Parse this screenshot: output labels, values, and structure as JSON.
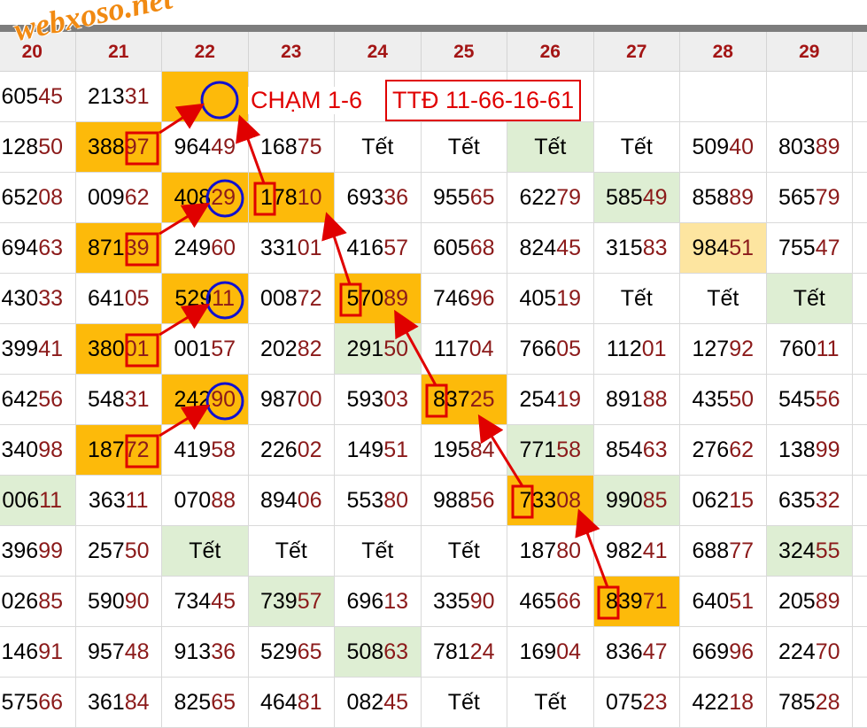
{
  "logo": {
    "text": "webxoso.net"
  },
  "headers": [
    "20",
    "21",
    "22",
    "23",
    "24",
    "25",
    "26",
    "27",
    "28",
    "29"
  ],
  "rows": [
    [
      "60545",
      "21331",
      "",
      "",
      "",
      "",
      "",
      "",
      "",
      ""
    ],
    [
      "12850",
      "38897",
      "96449",
      "16875",
      "Tết",
      "Tết",
      "Tết",
      "Tết",
      "50940",
      "80389"
    ],
    [
      "65208",
      "00962",
      "40829",
      "17810",
      "69336",
      "95565",
      "62279",
      "58549",
      "85889",
      "56579"
    ],
    [
      "69463",
      "87139",
      "24960",
      "33101",
      "41657",
      "60568",
      "82445",
      "31583",
      "98451",
      "75547"
    ],
    [
      "43033",
      "64105",
      "52911",
      "00872",
      "57089",
      "74696",
      "40519",
      "Tết",
      "Tết",
      "Tết"
    ],
    [
      "39941",
      "38001",
      "00157",
      "20282",
      "29150",
      "11704",
      "76605",
      "11201",
      "12792",
      "76011"
    ],
    [
      "64256",
      "54831",
      "24290",
      "98700",
      "59303",
      "83725",
      "25419",
      "89188",
      "43550",
      "54556"
    ],
    [
      "34098",
      "18772",
      "41958",
      "22602",
      "14951",
      "19584",
      "77158",
      "85463",
      "27662",
      "13899"
    ],
    [
      "00611",
      "36311",
      "07088",
      "89406",
      "55380",
      "98856",
      "73308",
      "99085",
      "06215",
      "63532"
    ],
    [
      "39699",
      "25750",
      "Tết",
      "Tết",
      "Tết",
      "Tết",
      "18780",
      "98241",
      "68877",
      "32455"
    ],
    [
      "02685",
      "59090",
      "73445",
      "73957",
      "69613",
      "33590",
      "46566",
      "83971",
      "64051",
      "20589"
    ],
    [
      "14691",
      "95748",
      "91336",
      "52965",
      "50863",
      "78124",
      "16904",
      "83647",
      "66996",
      "22470"
    ],
    [
      "57566",
      "36184",
      "82565",
      "46481",
      "08245",
      "Tết",
      "Tết",
      "07523",
      "42218",
      "78528"
    ]
  ],
  "highlights": {
    "orange": [
      "0-2",
      "1-1",
      "2-2",
      "2-3",
      "3-1",
      "4-2",
      "4-4",
      "5-1",
      "6-2",
      "6-5",
      "7-1",
      "8-6",
      "10-7"
    ],
    "green": [
      "1-6",
      "2-7",
      "4-9",
      "5-4",
      "7-6",
      "8-0",
      "8-7",
      "9-2",
      "9-9",
      "10-3",
      "11-4"
    ],
    "yellow": [
      "3-8"
    ]
  },
  "annotations": {
    "cham": "CHẠM 1-6",
    "ttd": "TTĐ 11-66-16-61"
  },
  "colors": {
    "accent": "#e00000",
    "circle": "#1010d0",
    "orange": "#fdba0a",
    "green": "#deeed3",
    "header_text": "#a31515"
  }
}
